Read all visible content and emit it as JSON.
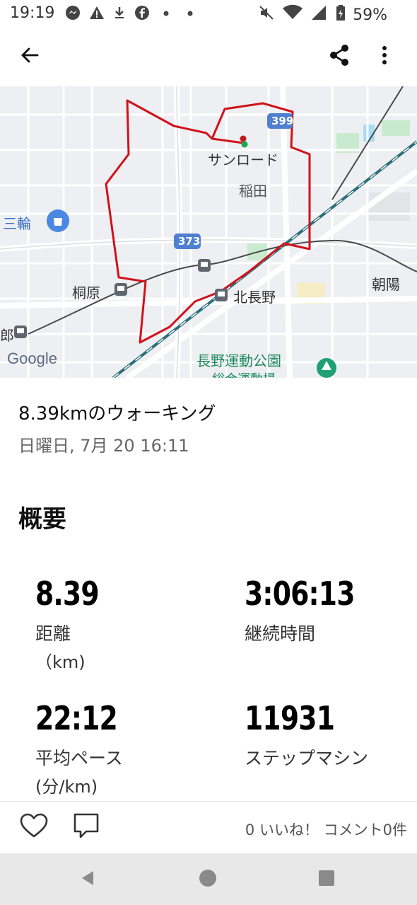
{
  "status_bar": {
    "time": "19:19",
    "battery": "59%"
  },
  "map": {
    "places": {
      "sunroad": "サンロード",
      "inada": "稲田",
      "sanwa": "三輪",
      "kirihara": "桐原",
      "kitanagano": "北長野",
      "asahi": "朝陽",
      "park": "長野運動公園",
      "park_sub": "総合運動場",
      "partial_left": "郎"
    },
    "routes": {
      "r399": "399",
      "r373": "373"
    },
    "google_logo": "Google",
    "route_color": "#d0121b"
  },
  "activity": {
    "title": "8.39kmのウォーキング",
    "datetime": "日曜日, 7月 20 16:11"
  },
  "summary": {
    "heading": "概要",
    "stats": [
      {
        "value": "8.39",
        "label": "距離",
        "unit": "（km)"
      },
      {
        "value": "3:06:13",
        "label": "継続時間",
        "unit": ""
      },
      {
        "value": "22:12",
        "label": "平均ペース",
        "unit": "(分/km)"
      },
      {
        "value": "11931",
        "label": "ステップマシン",
        "unit": ""
      }
    ]
  },
  "actions": {
    "counts": "0 いいね！ コメント0件"
  }
}
